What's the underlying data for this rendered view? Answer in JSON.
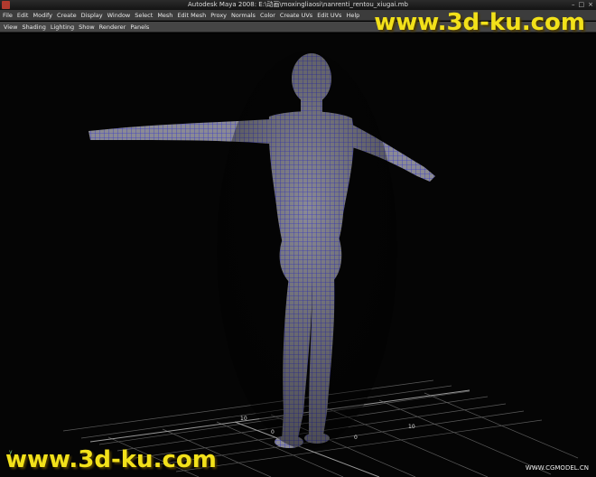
{
  "window": {
    "title": "Autodesk Maya 2008: E:\\动画\\moxingliaosi\\nanrenti_rentou_xiugai.mb",
    "buttons": [
      "–",
      "□",
      "×"
    ]
  },
  "menubar": {
    "items": [
      "File",
      "Edit",
      "Modify",
      "Create",
      "Display",
      "Window",
      "Select",
      "Mesh",
      "Edit Mesh",
      "Proxy",
      "Normals",
      "Color",
      "Create UVs",
      "Edit UVs",
      "Help"
    ]
  },
  "panel_menu": {
    "items": [
      "View",
      "Shading",
      "Lighting",
      "Show",
      "Renderer",
      "Panels"
    ]
  },
  "viewport": {
    "grid_labels": [
      "10",
      "10",
      "0",
      "0"
    ],
    "axis_labels": [
      "y",
      "x"
    ]
  },
  "watermarks": {
    "top": "www.3d-ku.com",
    "bottom": "www.3d-ku.com",
    "corner": "WWW.CGMODEL.CN"
  },
  "colors": {
    "wireframe": "#3a3ac8",
    "mesh_shade": "#8c8c96",
    "watermark": "#f2e11a"
  }
}
